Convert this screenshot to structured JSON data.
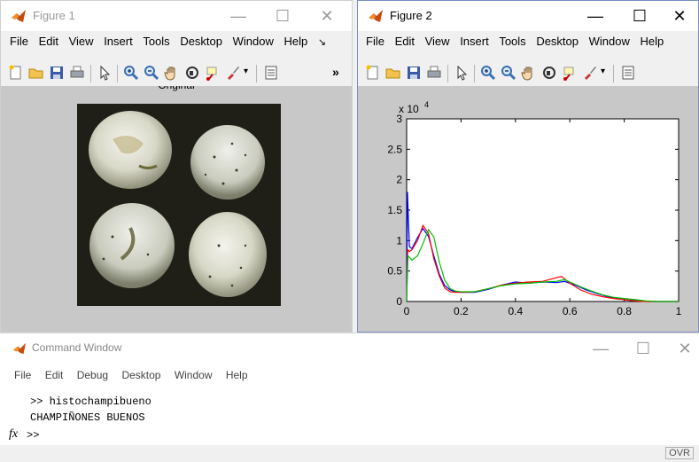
{
  "figure1": {
    "title": "Figure 1",
    "menu": [
      "File",
      "Edit",
      "View",
      "Insert",
      "Tools",
      "Desktop",
      "Window",
      "Help"
    ],
    "more_menu": "↘",
    "toolbar_overflow": "»",
    "axes_title": "Original"
  },
  "figure2": {
    "title": "Figure 2",
    "menu": [
      "File",
      "Edit",
      "View",
      "Insert",
      "Tools",
      "Desktop",
      "Window",
      "Help"
    ]
  },
  "window_controls": {
    "minimize": "—",
    "maximize": "☐",
    "close": "✕"
  },
  "command_window": {
    "title": "Command Window",
    "menu": [
      "File",
      "Edit",
      "Debug",
      "Desktop",
      "Window",
      "Help"
    ],
    "lines": [
      ">> histochampibueno",
      "CHAMPIÑONES BUENOS"
    ],
    "fx": "fx",
    "prompt": ">>",
    "status": "OVR"
  },
  "colors": {
    "red": "#ff0000",
    "green": "#00c000",
    "blue": "#0000ff"
  },
  "chart_data": {
    "type": "line",
    "title": "",
    "xlabel": "",
    "ylabel": "",
    "xlim": [
      0,
      1
    ],
    "ylim": [
      0,
      30000
    ],
    "exponent_label": "x 10",
    "exponent_power": "4",
    "xticks": [
      "0",
      "0.2",
      "0.4",
      "0.6",
      "0.8",
      "1"
    ],
    "yticks": [
      "0",
      "0.5",
      "1",
      "1.5",
      "2",
      "2.5",
      "3"
    ],
    "series": [
      {
        "color": "#0000ff",
        "x": [
          0,
          0.003,
          0.01,
          0.02,
          0.04,
          0.06,
          0.08,
          0.1,
          0.12,
          0.14,
          0.16,
          0.18,
          0.2,
          0.25,
          0.3,
          0.35,
          0.4,
          0.45,
          0.5,
          0.55,
          0.58,
          0.62,
          0.66,
          0.7,
          0.74,
          0.78,
          0.82,
          0.86,
          0.9,
          1.0
        ],
        "y": [
          0,
          18000,
          9000,
          8700,
          10500,
          12000,
          10700,
          7500,
          4500,
          2600,
          1900,
          1600,
          1500,
          1500,
          2000,
          2700,
          3200,
          3000,
          3200,
          3100,
          3300,
          2700,
          1900,
          1300,
          800,
          500,
          200,
          100,
          0,
          0
        ]
      },
      {
        "color": "#ff0000",
        "x": [
          0,
          0.004,
          0.01,
          0.02,
          0.04,
          0.06,
          0.08,
          0.1,
          0.12,
          0.14,
          0.16,
          0.18,
          0.2,
          0.25,
          0.3,
          0.35,
          0.4,
          0.45,
          0.5,
          0.55,
          0.57,
          0.6,
          0.64,
          0.68,
          0.72,
          0.76,
          0.8,
          0.84,
          0.88,
          1.0
        ],
        "y": [
          0,
          8500,
          8200,
          8500,
          10000,
          12500,
          11200,
          7000,
          4200,
          2200,
          1600,
          1500,
          1500,
          1600,
          2100,
          2700,
          3000,
          3200,
          3300,
          3900,
          4100,
          3000,
          1900,
          1200,
          800,
          500,
          300,
          100,
          0,
          0
        ]
      },
      {
        "color": "#00c000",
        "x": [
          0,
          0.005,
          0.02,
          0.04,
          0.06,
          0.08,
          0.1,
          0.12,
          0.14,
          0.16,
          0.18,
          0.2,
          0.25,
          0.3,
          0.35,
          0.4,
          0.45,
          0.5,
          0.55,
          0.58,
          0.6,
          0.64,
          0.68,
          0.72,
          0.76,
          0.8,
          0.84,
          0.88,
          0.92,
          1.0
        ],
        "y": [
          0,
          7500,
          6800,
          7500,
          9500,
          11800,
          10600,
          6500,
          3500,
          2100,
          1700,
          1600,
          1600,
          2100,
          2600,
          2900,
          3000,
          3200,
          3300,
          3600,
          3200,
          2400,
          1700,
          1100,
          700,
          500,
          300,
          100,
          0,
          0
        ]
      }
    ]
  }
}
